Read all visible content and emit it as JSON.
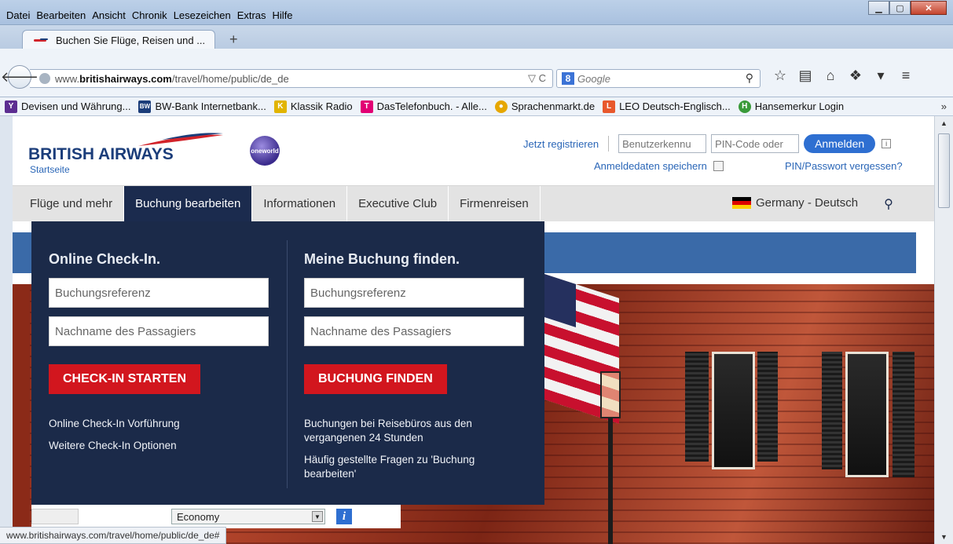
{
  "browser": {
    "menu": [
      "Datei",
      "Bearbeiten",
      "Ansicht",
      "Chronik",
      "Lesezeichen",
      "Extras",
      "Hilfe"
    ],
    "tab_title": "Buchen Sie Flüge, Reisen und ...",
    "new_tab": "+",
    "url_prefix": "www.",
    "url_domain": "britishairways.com",
    "url_path": "/travel/home/public/de_de",
    "search_placeholder": "Google",
    "bookmarks": [
      {
        "label": "Devisen und Währung...",
        "icon": "yahoo-icon",
        "color": "#5c2d91",
        "glyph": "Y"
      },
      {
        "label": "BW-Bank Internetbank...",
        "icon": "bw-bank-icon",
        "color": "#1b3d7a",
        "glyph": "BW"
      },
      {
        "label": "Klassik Radio",
        "icon": "klassik-radio-icon",
        "color": "#e1b400",
        "glyph": "K"
      },
      {
        "label": "DasTelefonbuch. - Alle...",
        "icon": "telekom-icon",
        "color": "#e20074",
        "glyph": "T"
      },
      {
        "label": "Sprachenmarkt.de",
        "icon": "sprachenmarkt-icon",
        "color": "#e6a700",
        "glyph": "●"
      },
      {
        "label": "LEO Deutsch-Englisch...",
        "icon": "leo-icon",
        "color": "#e8582c",
        "glyph": "L"
      },
      {
        "label": "Hansemerkur Login",
        "icon": "hansemerkur-icon",
        "color": "#3a9a3a",
        "glyph": "H"
      }
    ],
    "bookmarks_more": "»",
    "status_url": "www.britishairways.com/travel/home/public/de_de#"
  },
  "site": {
    "brand": "BRITISH AIRWAYS",
    "home_link": "Startseite",
    "oneworld": "oneworld",
    "register_link": "Jetzt registrieren",
    "username_placeholder": "Benutzerkennu",
    "pin_placeholder": "PIN-Code oder",
    "login_button": "Anmelden",
    "info_glyph": "i",
    "remember_label": "Anmeldedaten speichern",
    "forgot_link": "PIN/Passwort vergessen?",
    "nav": [
      "Flüge und mehr",
      "Buchung bearbeiten",
      "Informationen",
      "Executive Club",
      "Firmenreisen"
    ],
    "nav_active": 1,
    "language": "Germany - Deutsch"
  },
  "dropdown": {
    "checkin": {
      "title": "Online Check-In.",
      "field1": "Buchungsreferenz",
      "field2": "Nachname des Passagiers",
      "button": "CHECK-IN STARTEN",
      "links": [
        "Online Check-In Vorführung",
        "Weitere Check-In Optionen"
      ]
    },
    "find": {
      "title": "Meine Buchung finden.",
      "field1": "Buchungsreferenz",
      "field2": "Nachname des Passagiers",
      "button": "BUCHUNG FINDEN",
      "links": [
        "Buchungen bei Reisebüros aus den vergangenen 24 Stunden",
        "Häufig gestellte Fragen zu 'Buchung bearbeiten'"
      ]
    }
  },
  "booking": {
    "cabin_class": "Economy",
    "info_glyph": "i"
  }
}
